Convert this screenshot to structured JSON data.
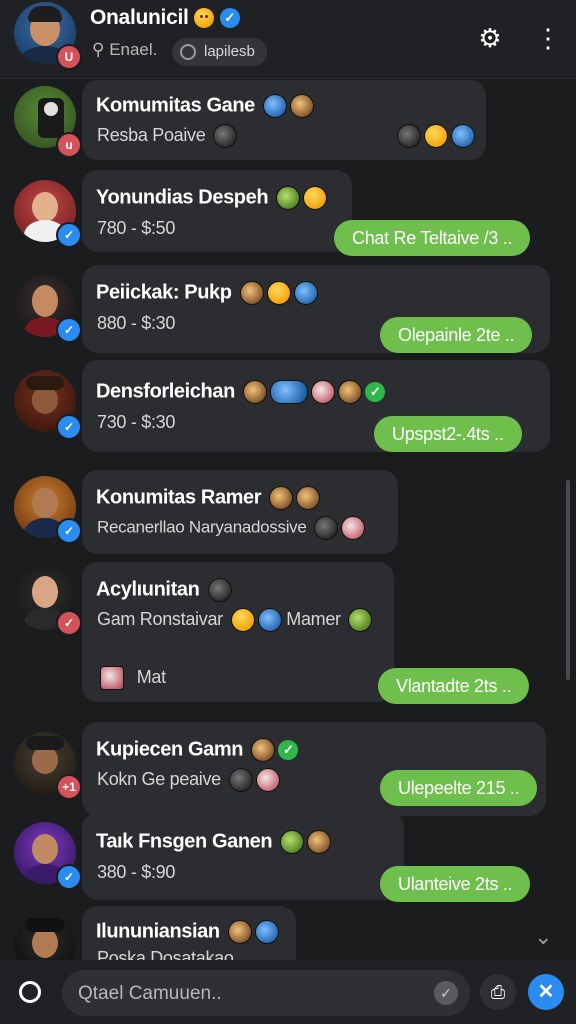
{
  "header": {
    "title": "Onalunicil",
    "search_hint": "Enael.",
    "chip_label": "lapilesb",
    "icons": [
      "gear-icon",
      "more-vert-icon",
      "search-icon"
    ]
  },
  "conversations": [
    {
      "name": "Komumitas Gane",
      "subtitle": "Resba Poaive",
      "pill": ""
    },
    {
      "name": "Yonundias Despeh",
      "subtitle": "780 - $:50",
      "pill": "Chat Re Teltaive /3 .."
    },
    {
      "name": "Peiickak: Pukp",
      "subtitle": "880 - $:30",
      "pill": "Olepainle 2te .."
    },
    {
      "name": "Densforleichan",
      "subtitle": "730 - $:30",
      "pill": "Upspst2-.4ts .."
    },
    {
      "name": "Konumitas Ramer",
      "subtitle": "Recanerllao Naryanadossive",
      "pill": ""
    },
    {
      "name": "Acylıunitan",
      "subtitle": "Gam Ronstaivar",
      "subtitle_extra": "Mamer",
      "third_line": "Mat",
      "pill": "Vlantadte 2ts .."
    },
    {
      "name": "Kupiecen Gamn",
      "subtitle": "Kokn Ge peaive",
      "pill": "Ulepeelte 215 .."
    },
    {
      "name": "Taık Fnsgen Ganen",
      "subtitle": "380 - $:90",
      "pill": "Ulanteive 2ts .."
    },
    {
      "name": "Ilununiansian",
      "subtitle": "Poska Dosatakao",
      "pill": ""
    }
  ],
  "compose": {
    "placeholder": "Qtael Camuuen.."
  },
  "colors": {
    "accent_green": "#6fbf4d",
    "verified_blue": "#2a8cf0",
    "send_blue": "#2a8cf0",
    "badge_red": "#d4535b"
  }
}
